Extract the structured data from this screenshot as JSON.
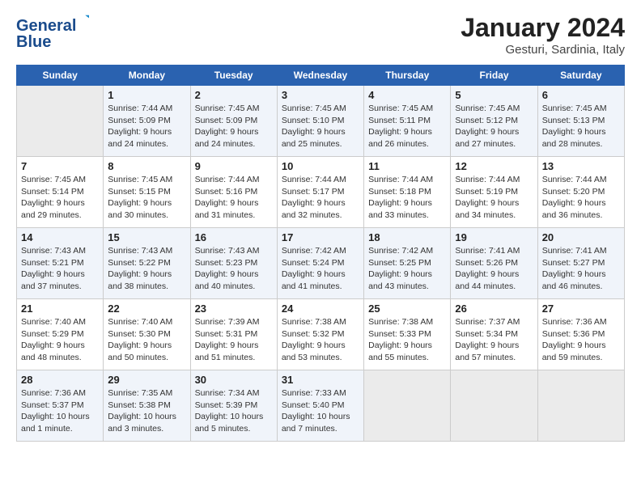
{
  "header": {
    "logo_line1": "General",
    "logo_line2": "Blue",
    "month": "January 2024",
    "location": "Gesturi, Sardinia, Italy"
  },
  "weekdays": [
    "Sunday",
    "Monday",
    "Tuesday",
    "Wednesday",
    "Thursday",
    "Friday",
    "Saturday"
  ],
  "weeks": [
    [
      {
        "day": "",
        "empty": true
      },
      {
        "day": "1",
        "sunrise": "Sunrise: 7:44 AM",
        "sunset": "Sunset: 5:09 PM",
        "daylight": "Daylight: 9 hours and 24 minutes."
      },
      {
        "day": "2",
        "sunrise": "Sunrise: 7:45 AM",
        "sunset": "Sunset: 5:09 PM",
        "daylight": "Daylight: 9 hours and 24 minutes."
      },
      {
        "day": "3",
        "sunrise": "Sunrise: 7:45 AM",
        "sunset": "Sunset: 5:10 PM",
        "daylight": "Daylight: 9 hours and 25 minutes."
      },
      {
        "day": "4",
        "sunrise": "Sunrise: 7:45 AM",
        "sunset": "Sunset: 5:11 PM",
        "daylight": "Daylight: 9 hours and 26 minutes."
      },
      {
        "day": "5",
        "sunrise": "Sunrise: 7:45 AM",
        "sunset": "Sunset: 5:12 PM",
        "daylight": "Daylight: 9 hours and 27 minutes."
      },
      {
        "day": "6",
        "sunrise": "Sunrise: 7:45 AM",
        "sunset": "Sunset: 5:13 PM",
        "daylight": "Daylight: 9 hours and 28 minutes."
      }
    ],
    [
      {
        "day": "7",
        "sunrise": "Sunrise: 7:45 AM",
        "sunset": "Sunset: 5:14 PM",
        "daylight": "Daylight: 9 hours and 29 minutes."
      },
      {
        "day": "8",
        "sunrise": "Sunrise: 7:45 AM",
        "sunset": "Sunset: 5:15 PM",
        "daylight": "Daylight: 9 hours and 30 minutes."
      },
      {
        "day": "9",
        "sunrise": "Sunrise: 7:44 AM",
        "sunset": "Sunset: 5:16 PM",
        "daylight": "Daylight: 9 hours and 31 minutes."
      },
      {
        "day": "10",
        "sunrise": "Sunrise: 7:44 AM",
        "sunset": "Sunset: 5:17 PM",
        "daylight": "Daylight: 9 hours and 32 minutes."
      },
      {
        "day": "11",
        "sunrise": "Sunrise: 7:44 AM",
        "sunset": "Sunset: 5:18 PM",
        "daylight": "Daylight: 9 hours and 33 minutes."
      },
      {
        "day": "12",
        "sunrise": "Sunrise: 7:44 AM",
        "sunset": "Sunset: 5:19 PM",
        "daylight": "Daylight: 9 hours and 34 minutes."
      },
      {
        "day": "13",
        "sunrise": "Sunrise: 7:44 AM",
        "sunset": "Sunset: 5:20 PM",
        "daylight": "Daylight: 9 hours and 36 minutes."
      }
    ],
    [
      {
        "day": "14",
        "sunrise": "Sunrise: 7:43 AM",
        "sunset": "Sunset: 5:21 PM",
        "daylight": "Daylight: 9 hours and 37 minutes."
      },
      {
        "day": "15",
        "sunrise": "Sunrise: 7:43 AM",
        "sunset": "Sunset: 5:22 PM",
        "daylight": "Daylight: 9 hours and 38 minutes."
      },
      {
        "day": "16",
        "sunrise": "Sunrise: 7:43 AM",
        "sunset": "Sunset: 5:23 PM",
        "daylight": "Daylight: 9 hours and 40 minutes."
      },
      {
        "day": "17",
        "sunrise": "Sunrise: 7:42 AM",
        "sunset": "Sunset: 5:24 PM",
        "daylight": "Daylight: 9 hours and 41 minutes."
      },
      {
        "day": "18",
        "sunrise": "Sunrise: 7:42 AM",
        "sunset": "Sunset: 5:25 PM",
        "daylight": "Daylight: 9 hours and 43 minutes."
      },
      {
        "day": "19",
        "sunrise": "Sunrise: 7:41 AM",
        "sunset": "Sunset: 5:26 PM",
        "daylight": "Daylight: 9 hours and 44 minutes."
      },
      {
        "day": "20",
        "sunrise": "Sunrise: 7:41 AM",
        "sunset": "Sunset: 5:27 PM",
        "daylight": "Daylight: 9 hours and 46 minutes."
      }
    ],
    [
      {
        "day": "21",
        "sunrise": "Sunrise: 7:40 AM",
        "sunset": "Sunset: 5:29 PM",
        "daylight": "Daylight: 9 hours and 48 minutes."
      },
      {
        "day": "22",
        "sunrise": "Sunrise: 7:40 AM",
        "sunset": "Sunset: 5:30 PM",
        "daylight": "Daylight: 9 hours and 50 minutes."
      },
      {
        "day": "23",
        "sunrise": "Sunrise: 7:39 AM",
        "sunset": "Sunset: 5:31 PM",
        "daylight": "Daylight: 9 hours and 51 minutes."
      },
      {
        "day": "24",
        "sunrise": "Sunrise: 7:38 AM",
        "sunset": "Sunset: 5:32 PM",
        "daylight": "Daylight: 9 hours and 53 minutes."
      },
      {
        "day": "25",
        "sunrise": "Sunrise: 7:38 AM",
        "sunset": "Sunset: 5:33 PM",
        "daylight": "Daylight: 9 hours and 55 minutes."
      },
      {
        "day": "26",
        "sunrise": "Sunrise: 7:37 AM",
        "sunset": "Sunset: 5:34 PM",
        "daylight": "Daylight: 9 hours and 57 minutes."
      },
      {
        "day": "27",
        "sunrise": "Sunrise: 7:36 AM",
        "sunset": "Sunset: 5:36 PM",
        "daylight": "Daylight: 9 hours and 59 minutes."
      }
    ],
    [
      {
        "day": "28",
        "sunrise": "Sunrise: 7:36 AM",
        "sunset": "Sunset: 5:37 PM",
        "daylight": "Daylight: 10 hours and 1 minute."
      },
      {
        "day": "29",
        "sunrise": "Sunrise: 7:35 AM",
        "sunset": "Sunset: 5:38 PM",
        "daylight": "Daylight: 10 hours and 3 minutes."
      },
      {
        "day": "30",
        "sunrise": "Sunrise: 7:34 AM",
        "sunset": "Sunset: 5:39 PM",
        "daylight": "Daylight: 10 hours and 5 minutes."
      },
      {
        "day": "31",
        "sunrise": "Sunrise: 7:33 AM",
        "sunset": "Sunset: 5:40 PM",
        "daylight": "Daylight: 10 hours and 7 minutes."
      },
      {
        "day": "",
        "empty": true
      },
      {
        "day": "",
        "empty": true
      },
      {
        "day": "",
        "empty": true
      }
    ]
  ]
}
